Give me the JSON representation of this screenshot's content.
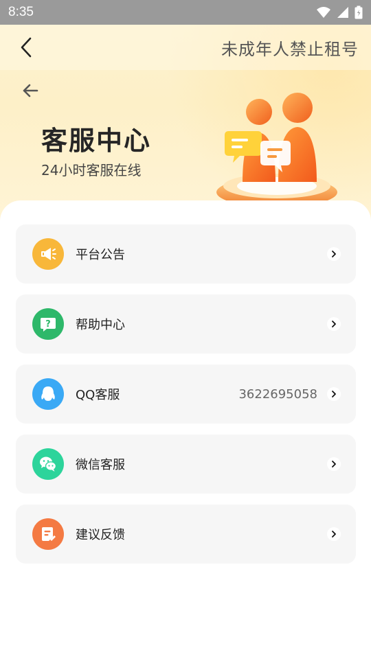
{
  "status_bar": {
    "time": "8:35"
  },
  "nav": {
    "right_link": "未成年人禁止租号"
  },
  "hero": {
    "title": "客服中心",
    "subtitle": "24小时客服在线"
  },
  "menu": [
    {
      "label": "平台公告",
      "value": "",
      "icon": "megaphone-icon",
      "color": "#f8b73a"
    },
    {
      "label": "帮助中心",
      "value": "",
      "icon": "help-chat-icon",
      "color": "#2eb86a"
    },
    {
      "label": "QQ客服",
      "value": "3622695058",
      "icon": "qq-penguin-icon",
      "color": "#3aa9f5"
    },
    {
      "label": "微信客服",
      "value": "",
      "icon": "wechat-icon",
      "color": "#2dd49b"
    },
    {
      "label": "建议反馈",
      "value": "",
      "icon": "feedback-note-icon",
      "color": "#f47a43"
    }
  ]
}
